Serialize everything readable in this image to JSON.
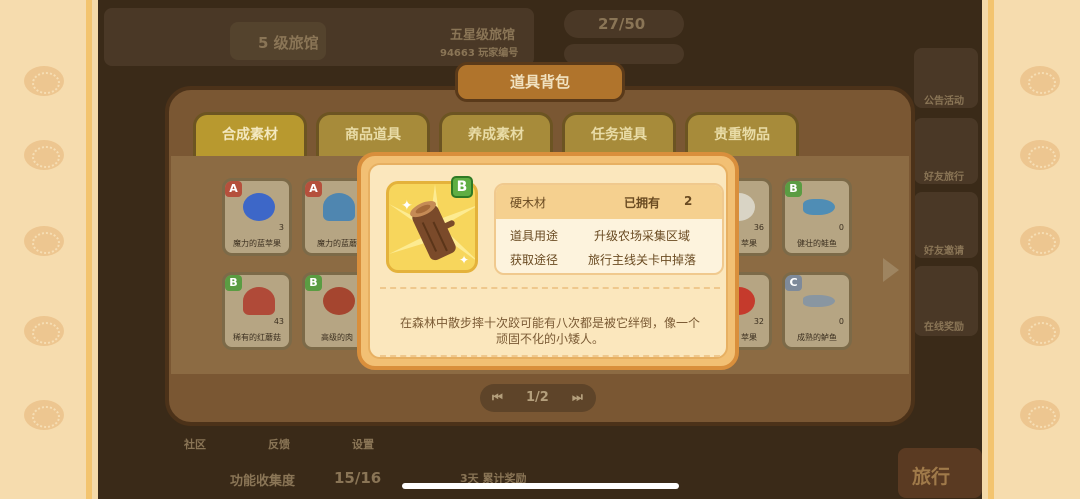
{
  "background": {
    "hotel_level": "5 级旅馆",
    "hotel_name": "五星级旅馆",
    "hotel_id": "94663 玩家编号",
    "energy": "27/50",
    "side_menu": [
      "公告活动",
      "好友旅行",
      "好友邀请",
      "在线奖励"
    ],
    "bottom_nav": [
      "社区",
      "反馈",
      "设置"
    ],
    "collection_label": "功能收集度",
    "collection_value": "15/16",
    "travel_button": "旅行",
    "bonus_text": "3天 累计奖励"
  },
  "backpack": {
    "title": "道具背包",
    "tabs": [
      "合成素材",
      "商品道具",
      "养成素材",
      "任务道具",
      "贵重物品"
    ],
    "active_tab": 0,
    "items": [
      {
        "grade": "A",
        "name": "魔力的蓝苹果",
        "count": "3",
        "icon": "blue-apple-icon",
        "color": "#3d67c8"
      },
      {
        "grade": "A",
        "name": "魔力的蓝蘑",
        "count": "",
        "icon": "blue-mushroom-icon",
        "color": "#4f86b0"
      },
      {
        "grade": "",
        "name": "苹果",
        "count": "36",
        "icon": "apple-icon",
        "color": "#d9d4c5"
      },
      {
        "grade": "B",
        "name": "健壮的鲑鱼",
        "count": "0",
        "icon": "salmon-icon",
        "color": "#4f8db5"
      },
      {
        "grade": "B",
        "name": "稀有的红蘑菇",
        "count": "43",
        "icon": "red-mushroom-icon",
        "color": "#b04a38"
      },
      {
        "grade": "B",
        "name": "高级的肉",
        "count": "",
        "icon": "meat-icon",
        "color": "#a5452f"
      },
      {
        "grade": "",
        "name": "苹果",
        "count": "32",
        "icon": "red-apple-icon",
        "color": "#c53a2c"
      },
      {
        "grade": "C",
        "name": "成熟的鲈鱼",
        "count": "0",
        "icon": "bass-icon",
        "color": "#8996a1"
      }
    ],
    "page": "1/2"
  },
  "detail": {
    "grade": "B",
    "item_name": "硬木材",
    "owned_label": "已拥有",
    "owned_count": "2",
    "usage_label": "道具用途",
    "usage_value": "升级农场采集区域",
    "source_label": "获取途径",
    "source_value": "旅行主线关卡中掉落",
    "description": "在森林中散步摔十次跤可能有八次都是被它绊倒，像一个顽固不化的小矮人。"
  }
}
